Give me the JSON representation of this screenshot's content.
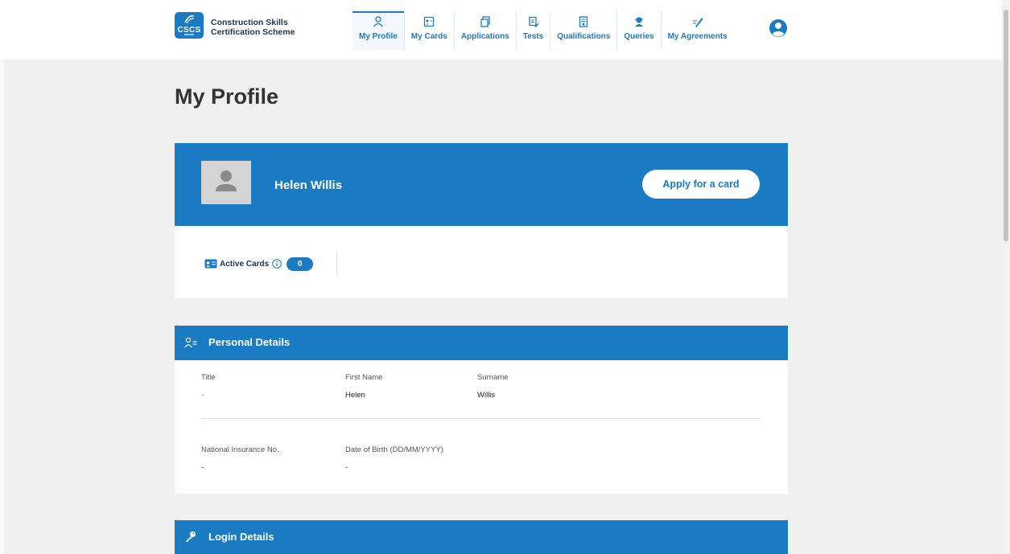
{
  "brand": {
    "logo_text": "CSCS",
    "name_line1": "Construction Skills",
    "name_line2": "Certification Scheme"
  },
  "nav": {
    "items": [
      {
        "label": "My Profile",
        "icon": "person-icon",
        "active": true
      },
      {
        "label": "My Cards",
        "icon": "id-card-icon",
        "active": false
      },
      {
        "label": "Applications",
        "icon": "documents-icon",
        "active": false
      },
      {
        "label": "Tests",
        "icon": "test-icon",
        "active": false
      },
      {
        "label": "Qualifications",
        "icon": "certificate-icon",
        "active": false
      },
      {
        "label": "Queries",
        "icon": "support-agent-icon",
        "active": false
      },
      {
        "label": "My Agreements",
        "icon": "signature-icon",
        "active": false
      }
    ],
    "account_icon": "account-circle-icon"
  },
  "page": {
    "title": "My Profile"
  },
  "profile": {
    "name": "Helen Willis",
    "apply_button": "Apply for a card",
    "active_cards_label": "Active Cards",
    "active_cards_count": "0"
  },
  "personal_details": {
    "title": "Personal Details",
    "fields": [
      {
        "label": "Title",
        "value": "-"
      },
      {
        "label": "First Name",
        "value": "Helen"
      },
      {
        "label": "Surname",
        "value": "Willis"
      },
      {
        "label": "National Insurance No.",
        "value": "-"
      },
      {
        "label": "Date of Birth (DD/MM/YYYY)",
        "value": "-"
      }
    ]
  },
  "login_details": {
    "title": "Login Details"
  },
  "colors": {
    "primary": "#1a7ac2",
    "background": "#f0f0f0",
    "text_dark": "#22364f"
  }
}
